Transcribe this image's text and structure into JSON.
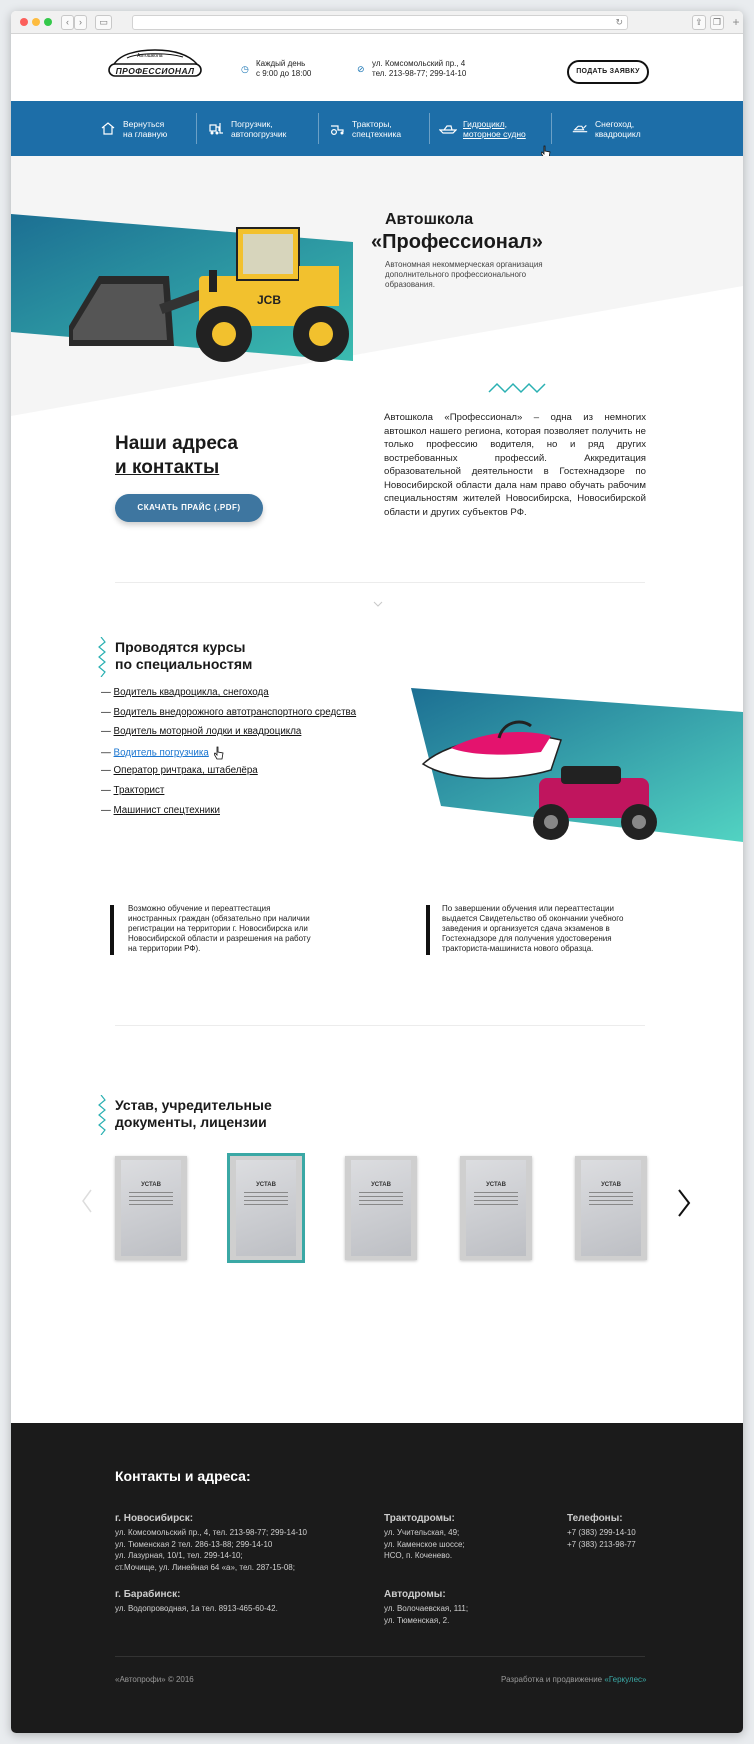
{
  "header": {
    "logo_small": "Автошкола",
    "logo_main": "ПРОФЕССИОНАЛ",
    "hours_line1": "Каждый день",
    "hours_line2": "с 9:00 до 18:00",
    "address_line1": "ул. Комсомольский пр., 4",
    "address_line2": "тел.  213-98-77; 299-14-10",
    "cta_label": "ПОДАТЬ ЗАЯВКУ"
  },
  "nav": [
    {
      "line1": "Вернуться",
      "line2": "на главную",
      "icon": "home-icon"
    },
    {
      "line1": "Погрузчик,",
      "line2": "автопогрузчик",
      "icon": "forklift-icon"
    },
    {
      "line1": "Тракторы,",
      "line2": "спецтехника",
      "icon": "tractor-icon"
    },
    {
      "line1": "Гидроцикл,",
      "line2": "моторное судно",
      "icon": "boat-icon"
    },
    {
      "line1": "Снегоход,",
      "line2": "квадроцикл",
      "icon": "snowmobile-icon"
    }
  ],
  "hero": {
    "title_line1": "Автошкола",
    "title_line2": "«Профессионал»",
    "subtitle": "Автономная некоммерческая организация дополнительного профессионального образования."
  },
  "contacts_block": {
    "title_line1": "Наши адреса",
    "title_line2": "и контакты",
    "price_button": "СКАЧАТЬ ПРАЙС (.PDF)",
    "about": "Автошкола «Профессионал» – одна из немногих автошкол нашего региона, которая позволяет получить не только профессию водителя, но и ряд других востребованных профессий. Аккредитация образовательной деятельности в Гостехнадзоре по Новосибирской области дала нам право обучать рабочим специальностям жителей Новосибирска, Новосибирской области и других субъектов РФ."
  },
  "courses": {
    "title_line1": "Проводятся курсы",
    "title_line2": "по специальностям",
    "items": [
      "Водитель квадроцикла, снегохода",
      "Водитель внедорожного автотранспортного средства",
      "Водитель моторной лодки и квадроцикла",
      "Водитель погрузчика",
      "Оператор ричтрака, штабелёра",
      "Тракторист",
      "Машинист спецтехники"
    ],
    "active_index": 3
  },
  "notes": {
    "left": "Возможно обучение и переаттестация иностранных граждан (обязательно при наличии регистрации на территории г. Новосибирска или Новосибирской области и разрешения на работу на территории РФ).",
    "right": "По завершении обучения или переаттестации выдается Свидетельство об окончании учебного заведения и организуется сдача экзаменов в Гостехнадзоре для получения удостоверения тракториста-машиниста нового образца."
  },
  "documents": {
    "title_line1": "Устав, учредительные",
    "title_line2": "документы, лицензии",
    "items": [
      "УСТАВ",
      "УСТАВ",
      "УСТАВ",
      "УСТАВ",
      "УСТАВ"
    ],
    "selected_index": 1
  },
  "footer": {
    "title": "Контакты и адреса:",
    "nsk_title": "г. Новосибирск:",
    "nsk_lines": [
      "ул. Комсомольский пр., 4, тел. 213-98-77; 299-14-10",
      "ул. Тюменская 2 тел. 286-13-88; 299-14-10",
      "ул. Лазурная, 10/1, тел. 299-14-10;",
      "ст.Мочище, ул. Линейная 64 «а», тел. 287-15-08;"
    ],
    "barabinsk_title": "г. Барабинск:",
    "barabinsk_lines": [
      "ул. Водопроводная, 1а тел. 8913-465-60-42."
    ],
    "tractor_title": "Трактодромы:",
    "tractor_lines": [
      "ул. Учительская, 49;",
      "ул. Каменское шоссе;",
      "НСО, п. Коченево."
    ],
    "auto_title": "Автодромы:",
    "auto_lines": [
      "ул. Волочаевская, 111;",
      "ул. Тюменская, 2."
    ],
    "phones_title": "Телефоны:",
    "phones_lines": [
      "+7 (383) 299-14-10",
      "+7 (383) 213-98-77"
    ],
    "copyright": "«Автопрофи» © 2016",
    "dev_text": "Разработка и продвижение",
    "dev_link": "«Геркулес»"
  }
}
